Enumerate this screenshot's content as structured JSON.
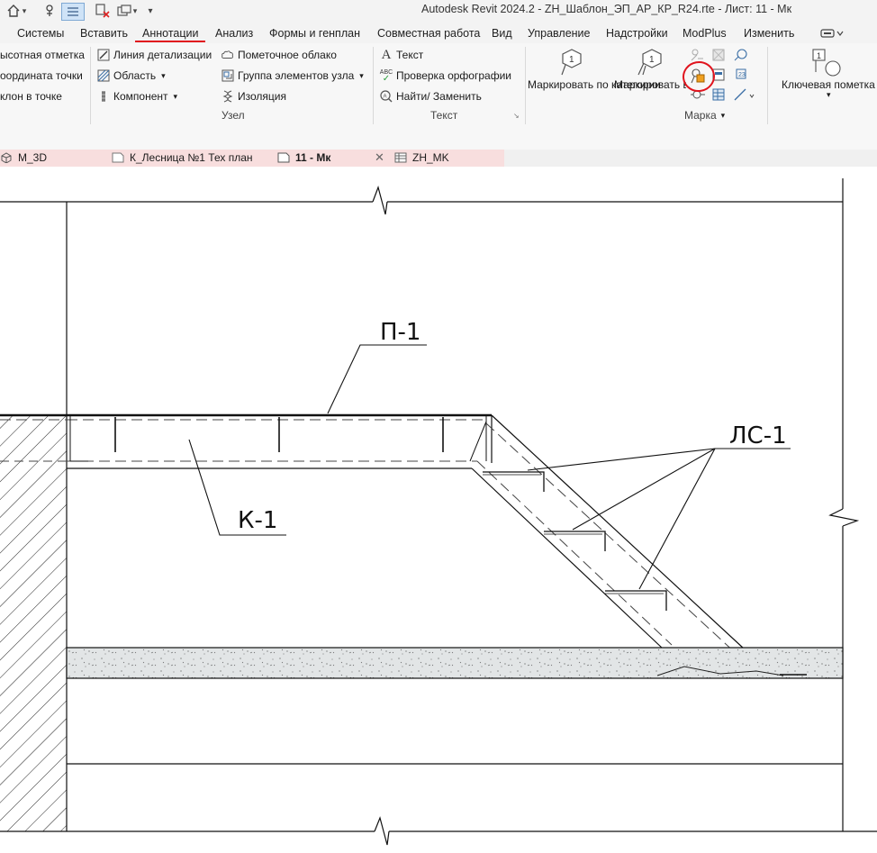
{
  "window": {
    "title": "Autodesk Revit 2024.2 - ZH_Шаблон_ЭП_АР_КР_R24.rte - Лист: 11 - Мк"
  },
  "ribbon_tabs": [
    {
      "label": "Системы"
    },
    {
      "label": "Вставить"
    },
    {
      "label": "Аннотации"
    },
    {
      "label": "Анализ"
    },
    {
      "label": "Формы и генплан"
    },
    {
      "label": "Совместная работа"
    },
    {
      "label": "Вид"
    },
    {
      "label": "Управление"
    },
    {
      "label": "Надстройки"
    },
    {
      "label": "ModPlus"
    },
    {
      "label": "Изменить"
    }
  ],
  "active_tab": "Аннотации",
  "ribbon": {
    "left_partial": [
      "ысотная отметка",
      "оордината точки",
      "клон  в точке"
    ],
    "detail": {
      "detail_line": "Линия детализации",
      "region": "Область",
      "component": "Компонент",
      "revision_cloud": "Пометочное облако",
      "detail_group": "Группа элементов узла",
      "insulation": "Изоляция",
      "panel_title": "Узел"
    },
    "text": {
      "text": "Текст",
      "spell_check": "Проверка  орфографии",
      "find_replace": "Найти/ Заменить",
      "panel_title": "Текст",
      "spell_icon_text": "ABC"
    },
    "tag": {
      "by_category": "Маркировать по категории",
      "tag_all": "Маркировать все",
      "panel_title": "Марка",
      "tag_icon_number": "1",
      "tag_all_icon_number": "1"
    },
    "keynote": {
      "label": "Ключевая пометка",
      "icon_number": "1"
    }
  },
  "view_tabs": [
    {
      "label": "M_3D"
    },
    {
      "label": "К_Лесница №1 Тех план"
    },
    {
      "label": "11 - Мк",
      "active": true
    },
    {
      "label": "ZH_MK"
    }
  ],
  "drawing": {
    "tag_p1": "П-1",
    "tag_k1": "К-1",
    "tag_ls1": "ЛС-1"
  },
  "colors": {
    "highlight_red": "#e0141e",
    "view_tab_bar": "#f8dede",
    "screed_fill": "#e2e5e6"
  },
  "icons": {
    "home": "home-icon",
    "measure": "measure-icon",
    "thin_lines": "thin-lines-icon",
    "close_hidden": "close-hidden-windows-icon",
    "switch_windows": "switch-windows-icon",
    "qat_dropdown": "qat-dropdown-icon",
    "view_sheet": "sheet-icon",
    "view_3d": "3d-view-icon",
    "schedule": "schedule-icon"
  }
}
